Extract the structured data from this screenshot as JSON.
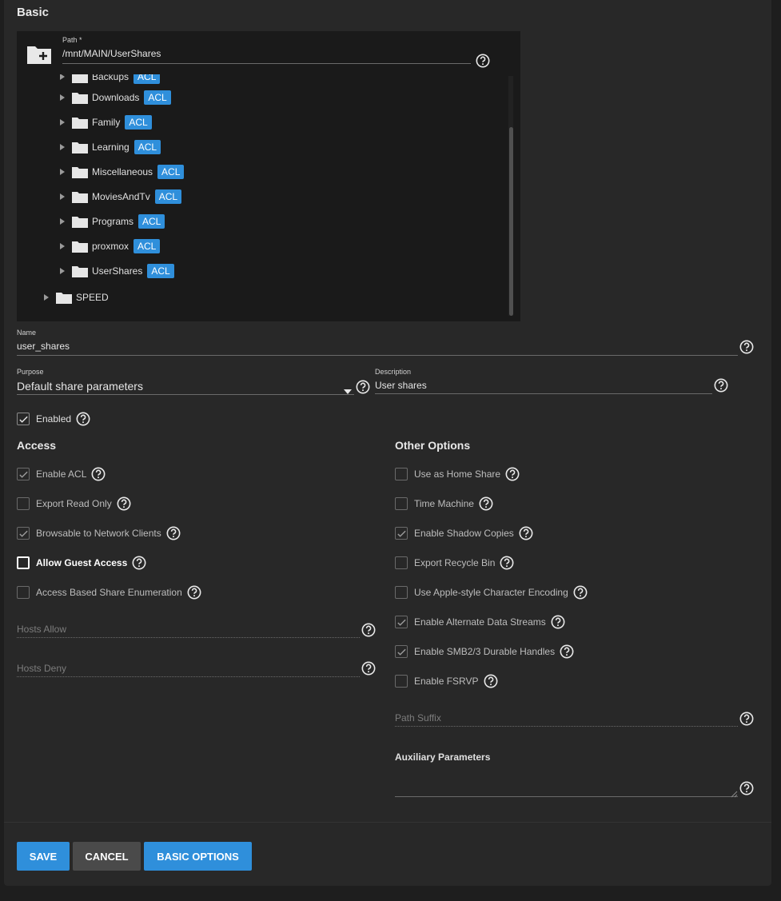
{
  "sections": {
    "basic": "Basic",
    "access": "Access",
    "other_options": "Other Options"
  },
  "path": {
    "label": "Path *",
    "value": "/mnt/MAIN/UserShares"
  },
  "tree": {
    "partial_item": "Backups",
    "items": [
      {
        "name": "Downloads",
        "acl": "ACL"
      },
      {
        "name": "Family",
        "acl": "ACL"
      },
      {
        "name": "Learning",
        "acl": "ACL"
      },
      {
        "name": "Miscellaneous",
        "acl": "ACL"
      },
      {
        "name": "MoviesAndTv",
        "acl": "ACL"
      },
      {
        "name": "Programs",
        "acl": "ACL"
      },
      {
        "name": "proxmox",
        "acl": "ACL"
      },
      {
        "name": "UserShares",
        "acl": "ACL"
      }
    ],
    "root_item": {
      "name": "SPEED"
    }
  },
  "name_field": {
    "label": "Name",
    "value": "user_shares"
  },
  "purpose_field": {
    "label": "Purpose",
    "value": "Default share parameters"
  },
  "description_field": {
    "label": "Description",
    "value": "User shares"
  },
  "enabled": {
    "label": "Enabled",
    "checked": true
  },
  "access": {
    "options": [
      {
        "label": "Enable ACL",
        "checked": true
      },
      {
        "label": "Export Read Only",
        "checked": false
      },
      {
        "label": "Browsable to Network Clients",
        "checked": true
      },
      {
        "label": "Allow Guest Access",
        "checked": false
      },
      {
        "label": "Access Based Share Enumeration",
        "checked": false
      }
    ],
    "hosts_allow_placeholder": "Hosts Allow",
    "hosts_deny_placeholder": "Hosts Deny"
  },
  "other": {
    "options": [
      {
        "label": "Use as Home Share",
        "checked": false
      },
      {
        "label": "Time Machine",
        "checked": false
      },
      {
        "label": "Enable Shadow Copies",
        "checked": true
      },
      {
        "label": "Export Recycle Bin",
        "checked": false
      },
      {
        "label": "Use Apple-style Character Encoding",
        "checked": false
      },
      {
        "label": "Enable Alternate Data Streams",
        "checked": true
      },
      {
        "label": "Enable SMB2/3 Durable Handles",
        "checked": true
      },
      {
        "label": "Enable FSRVP",
        "checked": false
      }
    ],
    "path_suffix_placeholder": "Path Suffix",
    "aux_label": "Auxiliary Parameters"
  },
  "buttons": {
    "save": "SAVE",
    "cancel": "CANCEL",
    "basic_options": "BASIC OPTIONS"
  },
  "colors": {
    "accent": "#2f8fdb",
    "background": "#282828",
    "tree_bg": "#1a1a1a"
  }
}
